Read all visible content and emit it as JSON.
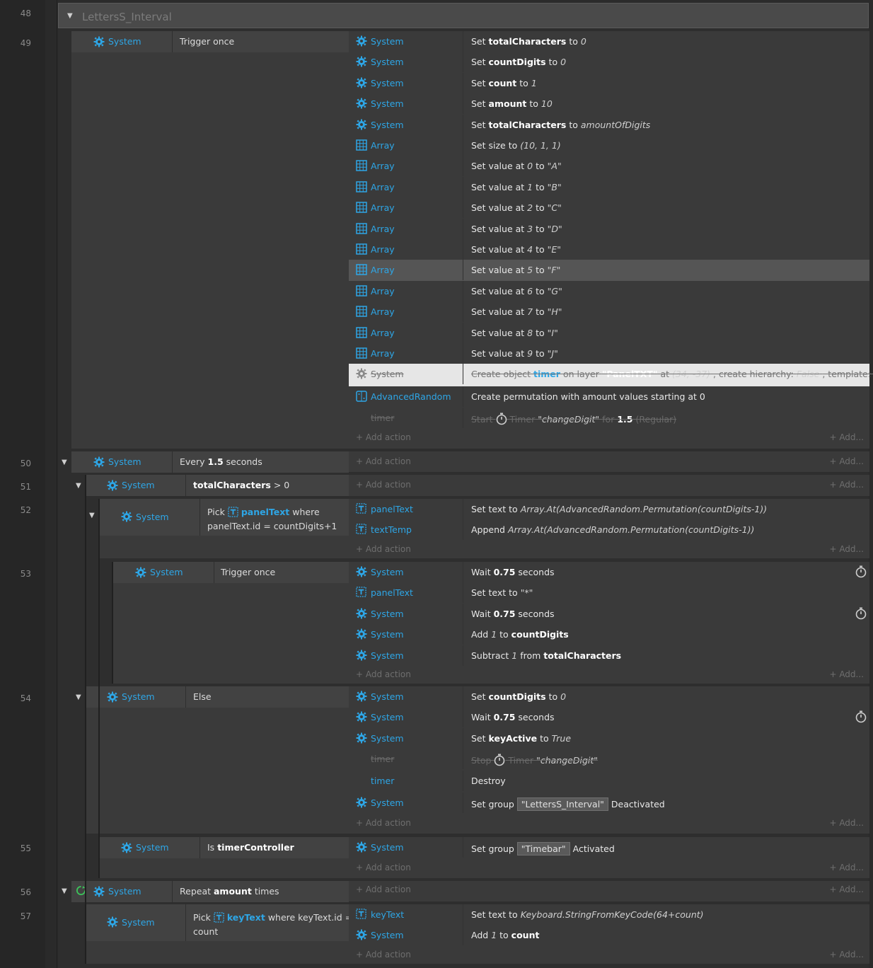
{
  "group": {
    "title": "LettersS_Interval"
  },
  "line_numbers": [
    "48",
    "49",
    "50",
    "51",
    "52",
    "53",
    "54",
    "55",
    "56",
    "57"
  ],
  "common": {
    "add_action": "Add action",
    "add_more": "Add..."
  },
  "events": {
    "e49": {
      "cond": {
        "object": "System",
        "text": "Trigger once"
      },
      "actions": [
        {
          "object": "System",
          "pre": "Set",
          "b": "totalCharacters",
          "mid": "to",
          "i": "0"
        },
        {
          "object": "System",
          "pre": "Set",
          "b": "countDigits",
          "mid": "to",
          "i": "0"
        },
        {
          "object": "System",
          "pre": "Set",
          "b": "count",
          "mid": "to",
          "i": "1"
        },
        {
          "object": "System",
          "pre": "Set",
          "b": "amount",
          "mid": "to",
          "i": "10"
        },
        {
          "object": "System",
          "pre": "Set",
          "b": "totalCharacters",
          "mid": "to",
          "i": "amountOfDigits"
        },
        {
          "object": "Array",
          "pre": "Set size to",
          "i": "(10, 1, 1)"
        },
        {
          "object": "Array",
          "pre": "Set value at",
          "i": "0",
          "mid": "to",
          "i2": "\"A\""
        },
        {
          "object": "Array",
          "pre": "Set value at",
          "i": "1",
          "mid": "to",
          "i2": "\"B\""
        },
        {
          "object": "Array",
          "pre": "Set value at",
          "i": "2",
          "mid": "to",
          "i2": "\"C\""
        },
        {
          "object": "Array",
          "pre": "Set value at",
          "i": "3",
          "mid": "to",
          "i2": "\"D\""
        },
        {
          "object": "Array",
          "pre": "Set value at",
          "i": "4",
          "mid": "to",
          "i2": "\"E\""
        },
        {
          "object": "Array",
          "pre": "Set value at",
          "i": "5",
          "mid": "to",
          "i2": "\"F\""
        },
        {
          "object": "Array",
          "pre": "Set value at",
          "i": "6",
          "mid": "to",
          "i2": "\"G\""
        },
        {
          "object": "Array",
          "pre": "Set value at",
          "i": "7",
          "mid": "to",
          "i2": "\"H\""
        },
        {
          "object": "Array",
          "pre": "Set value at",
          "i": "8",
          "mid": "to",
          "i2": "\"I\""
        },
        {
          "object": "Array",
          "pre": "Set value at",
          "i": "9",
          "mid": "to",
          "i2": "\"J\""
        },
        {
          "object": "System",
          "pre": "Create object",
          "b": "timer",
          "mid": "on layer",
          "b2": "\"PanelTXT\"",
          "post": "at",
          "i": "(34, -37)",
          "post2": ", create hierarchy:",
          "i2": "False",
          "post3": ", template: \"\""
        },
        {
          "object": "AdvancedRandom",
          "pre": "Create permutation with amount values starting at 0"
        },
        {
          "object": "timer",
          "pre": "Start",
          "post": "Timer",
          "i": "\"changeDigit\"",
          "mid": "for",
          "b": "1.5",
          "post2": "(Regular)"
        }
      ]
    },
    "e50": {
      "cond": {
        "object": "System",
        "pre": "Every",
        "b": "1.5",
        "post": "seconds"
      }
    },
    "e51": {
      "cond": {
        "object": "System",
        "b": "totalCharacters",
        "post": "> 0"
      }
    },
    "e52": {
      "cond": {
        "object": "System",
        "pre": "Pick",
        "b": "panelText",
        "post": "where",
        "line2": "panelText.id = countDigits+1"
      },
      "actions": [
        {
          "object": "panelText",
          "pre": "Set text to",
          "i": "Array.At(AdvancedRandom.Permutation(countDigits-1))"
        },
        {
          "object": "textTemp",
          "pre": "Append",
          "i": "Array.At(AdvancedRandom.Permutation(countDigits-1))"
        }
      ]
    },
    "e53": {
      "cond": {
        "object": "System",
        "text": "Trigger once"
      },
      "actions": [
        {
          "object": "System",
          "pre": "Wait",
          "b": "0.75",
          "post": "seconds"
        },
        {
          "object": "panelText",
          "pre": "Set text to",
          "i": "\"*\""
        },
        {
          "object": "System",
          "pre": "Wait",
          "b": "0.75",
          "post": "seconds"
        },
        {
          "object": "System",
          "pre": "Add",
          "i": "1",
          "mid": "to",
          "b": "countDigits"
        },
        {
          "object": "System",
          "pre": "Subtract",
          "i": "1",
          "mid": "from",
          "b": "totalCharacters"
        }
      ]
    },
    "e54": {
      "cond": {
        "object": "System",
        "text": "Else"
      },
      "actions": [
        {
          "object": "System",
          "pre": "Set",
          "b": "countDigits",
          "mid": "to",
          "i": "0"
        },
        {
          "object": "System",
          "pre": "Wait",
          "b": "0.75",
          "post": "seconds"
        },
        {
          "object": "System",
          "pre": "Set",
          "b": "keyActive",
          "mid": "to",
          "i": "True"
        },
        {
          "object": "timer",
          "pre": "Stop",
          "post": "Timer",
          "i": "\"changeDigit\""
        },
        {
          "object": "timer",
          "pre": "Destroy"
        },
        {
          "object": "System",
          "pre": "Set group",
          "tag": "\"LettersS_Interval\"",
          "post": "Deactivated"
        }
      ]
    },
    "e55": {
      "cond": {
        "object": "System",
        "pre": "Is",
        "b": "timerController"
      },
      "actions": [
        {
          "object": "System",
          "pre": "Set group",
          "tag": "\"Timebar\"",
          "post": "Activated"
        }
      ]
    },
    "e56": {
      "cond": {
        "object": "System",
        "pre": "Repeat",
        "b": "amount",
        "post": "times"
      }
    },
    "e57": {
      "cond": {
        "object": "System",
        "pre": "Pick",
        "b": "keyText",
        "post": "where keyText.id =",
        "line2": "count"
      },
      "actions": [
        {
          "object": "keyText",
          "pre": "Set text to",
          "i": "Keyboard.StringFromKeyCode(64+count)"
        },
        {
          "object": "System",
          "pre": "Add",
          "i": "1",
          "mid": "to",
          "b": "count"
        }
      ]
    }
  },
  "colors": {
    "object_name": "#2ea6e6",
    "background": "#2b2b2b",
    "selected_row": "#555555",
    "highlight_row": "#e6e6e6"
  }
}
